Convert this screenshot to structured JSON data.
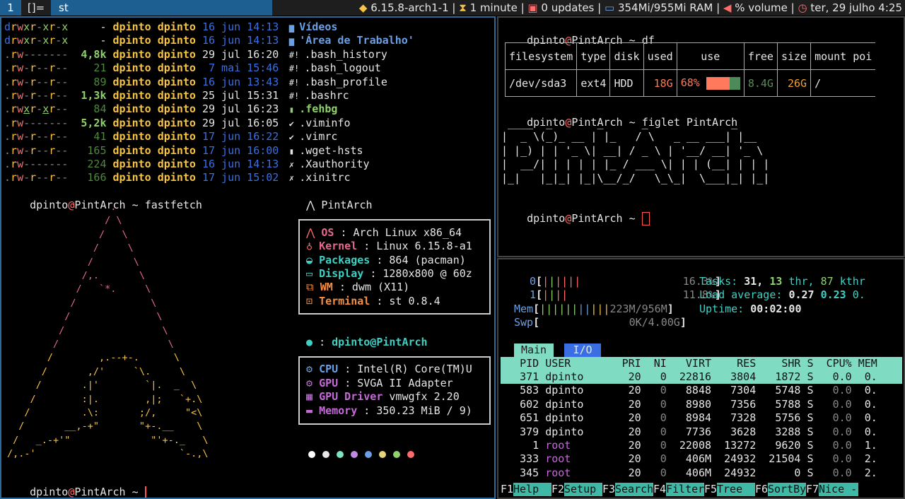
{
  "bar": {
    "tag1": "1",
    "layout": "[]=",
    "window_title": "st",
    "kernel": "6.15.8-arch1-1",
    "uptime": "1 minute",
    "updates": "0 updates",
    "ram": "354Mi/955Mi RAM",
    "volume": "% volume",
    "date": "ter, 29 julho 4:25",
    "sep": "|"
  },
  "ls": {
    "rows": [
      {
        "perm": "drwxr-xr-x",
        "size": "-",
        "user": "dpinto",
        "group": "dpinto",
        "day": "16",
        "mon": "jun",
        "time": "14:13",
        "name": "Vídeos",
        "icon": "folder"
      },
      {
        "perm": "drwxr-xr-x",
        "size": "-",
        "user": "dpinto",
        "group": "dpinto",
        "day": "16",
        "mon": "jun",
        "time": "14:13",
        "name": "'Área de Trabalho'",
        "icon": "folder"
      },
      {
        "perm": ".rw-------",
        "size": "4,8k",
        "user": "dpinto",
        "group": "dpinto",
        "day": "29",
        "mon": "jul",
        "time": "16:20",
        "name": ".bash_history",
        "icon": "hash"
      },
      {
        "perm": ".rw-r--r--",
        "size": "21",
        "user": "dpinto",
        "group": "dpinto",
        "day": "7",
        "mon": "mai",
        "time": "15:46",
        "name": ".bash_logout",
        "icon": "hash"
      },
      {
        "perm": ".rw-r--r--",
        "size": "89",
        "user": "dpinto",
        "group": "dpinto",
        "day": "16",
        "mon": "jun",
        "time": "13:43",
        "name": ".bash_profile",
        "icon": "hash"
      },
      {
        "perm": ".rw-r--r--",
        "size": "1,3k",
        "user": "dpinto",
        "group": "dpinto",
        "day": "25",
        "mon": "jul",
        "time": "15:31",
        "name": ".bashrc",
        "icon": "hash"
      },
      {
        "perm": ".rwxr-xr--",
        "size": "84",
        "user": "dpinto",
        "group": "dpinto",
        "day": "29",
        "mon": "jul",
        "time": "16:23",
        "name": ".fehbg",
        "icon": "file"
      },
      {
        "perm": ".rw-------",
        "size": "5,2k",
        "user": "dpinto",
        "group": "dpinto",
        "day": "29",
        "mon": "jul",
        "time": "16:05",
        "name": ".viminfo",
        "icon": "vim"
      },
      {
        "perm": ".rw-r--r--",
        "size": "41",
        "user": "dpinto",
        "group": "dpinto",
        "day": "17",
        "mon": "jun",
        "time": "16:22",
        "name": ".vimrc",
        "icon": "vim"
      },
      {
        "perm": ".rw-r--r--",
        "size": "165",
        "user": "dpinto",
        "group": "dpinto",
        "day": "17",
        "mon": "jun",
        "time": "16:00",
        "name": ".wget-hsts",
        "icon": "file"
      },
      {
        "perm": ".rw-------",
        "size": "224",
        "user": "dpinto",
        "group": "dpinto",
        "day": "16",
        "mon": "jun",
        "time": "14:13",
        "name": ".Xauthority",
        "icon": "x"
      },
      {
        "perm": ".rw-r--r--",
        "size": "166",
        "user": "dpinto",
        "group": "dpinto",
        "day": "17",
        "mon": "jun",
        "time": "15:02",
        "name": ".xinitrc",
        "icon": "x"
      }
    ]
  },
  "prompt": {
    "user": "dpinto",
    "at": "@",
    "host": "PintArch",
    "tilde": "~"
  },
  "cmd_fastfetch": "fastfetch",
  "fastfetch": {
    "host_title": "PintArch",
    "os_label": "OS",
    "os": "Arch Linux x86_64",
    "kernel_label": "Kernel",
    "kernel": "Linux 6.15.8-a1",
    "packages_label": "Packages",
    "packages": "864 (pacman)",
    "display_label": "Display",
    "display": "1280x800 @ 60z",
    "wm_label": "WM",
    "wm": "dwm (X11)",
    "terminal_label": "Terminal",
    "terminal": "st 0.8.4",
    "user_line": "dpinto@PintArch",
    "cpu_label": "CPU",
    "cpu": "Intel(R) Core(TM)U",
    "gpu_label": "GPU",
    "gpu": "SVGA II Adapter",
    "gpudrv_label": "GPU Driver",
    "gpudrv": "vmwgfx 2.20",
    "mem_label": "Memory",
    "mem": "350.23 MiB / 9)",
    "colon": ":",
    "dots": [
      "#ffffff",
      "#e6e6e6",
      "#7fe3c2",
      "#c08ae6",
      "#6aa0e6",
      "#e6d37a",
      "#8fd16b",
      "#ff6b6b"
    ]
  },
  "logo_lines": [
    "                  .",
    "                 / \\",
    "                /   \\",
    "               /     \\",
    "              /       \\",
    "             /,.       \\",
    "            /   `*.     \\",
    "           /             \\",
    "          /               \\",
    "         /                 \\",
    "        /                   \\",
    "       /        ,.--+-.      \\",
    "      /       ,/'     `\\.     \\",
    "     /       .|'        `|.  _  \\",
    "    /        :|.        ,|;   `+.\\",
    "   /         .\\:       ;/,     \"<\\",
    "  /       __,-+\"       \"+-.__    \\",
    " /   _.-+'\"              \"'+-._   \\",
    "/,.-'                         `-.,\\"
  ],
  "cmd_df": "df",
  "df": {
    "headers": [
      "filesystem",
      "type",
      "disk",
      "used",
      "use",
      "free",
      "size",
      "mount poi"
    ],
    "row": {
      "fs": "/dev/sda3",
      "type": "ext4",
      "disk": "HDD",
      "used": "18G",
      "pct": "68%",
      "pct_value": 0.68,
      "free": "8.4G",
      "size": "26G",
      "mount": "/"
    }
  },
  "cmd_figlet": "figlet PintArch",
  "figlet": [
    " ____  _       _      _             _",
    "|  _ \\(_)_ __ | |_   / \\   _ __ ___| |__",
    "| |_) | | '_ \\| __| / _ \\ | '__/ __| '_ \\",
    "|  __/| | | | | |_ / ___ \\| | | (__| | | |",
    "|_|   |_|_| |_|\\__/_/   \\_\\_|  \\___|_| |_|"
  ],
  "htop": {
    "cpu0_label": "0",
    "cpu0": "16.3%",
    "cpu1_label": "1",
    "cpu1": "11.8%",
    "mem_label": "Mem",
    "mem": "223M/956M",
    "swp_label": "Swp",
    "swp": "0K/4.00G",
    "tasks_label": "Tasks:",
    "tasks": "31,",
    "thr": "13",
    "thr_label": "thr,",
    "kthr": "87",
    "kthr_label": "kthr",
    "load_label": "Load average:",
    "load1": "0.27",
    "load5": "0.23",
    "load15": "0.",
    "uptime_label": "Uptime:",
    "uptime": "00:02:00",
    "tab_main": "Main",
    "tab_io": "I/O",
    "headers": [
      "PID",
      "USER",
      "PRI",
      "NI",
      "VIRT",
      "RES",
      "SHR",
      "S",
      "CPU%",
      "MEM"
    ],
    "rows": [
      [
        "371",
        "dpinto",
        "20",
        "0",
        "22816",
        "3804",
        "1872",
        "S",
        "0.0",
        "0."
      ],
      [
        "583",
        "dpinto",
        "20",
        "0",
        "8848",
        "7304",
        "5748",
        "S",
        "0.0",
        "0."
      ],
      [
        "602",
        "dpinto",
        "20",
        "0",
        "8980",
        "7356",
        "5788",
        "S",
        "0.0",
        "0."
      ],
      [
        "651",
        "dpinto",
        "20",
        "0",
        "8984",
        "7328",
        "5756",
        "S",
        "0.0",
        "0."
      ],
      [
        "379",
        "dpinto",
        "20",
        "0",
        "7736",
        "3628",
        "3288",
        "S",
        "0.0",
        "0."
      ],
      [
        "1",
        "root",
        "20",
        "0",
        "22008",
        "13272",
        "9620",
        "S",
        "0.0",
        "1."
      ],
      [
        "333",
        "root",
        "20",
        "0",
        "406M",
        "24932",
        "21504",
        "S",
        "0.0",
        "2."
      ],
      [
        "345",
        "root",
        "20",
        "0",
        "406M",
        "24932",
        "0",
        "S",
        "0.0",
        "2."
      ]
    ],
    "fkeys": [
      {
        "k": "F1",
        "l": "Help"
      },
      {
        "k": "F2",
        "l": "Setup"
      },
      {
        "k": "F3",
        "l": "Search"
      },
      {
        "k": "F4",
        "l": "Filter"
      },
      {
        "k": "F5",
        "l": "Tree"
      },
      {
        "k": "F6",
        "l": "SortBy"
      },
      {
        "k": "F7",
        "l": "Nice -"
      }
    ]
  }
}
